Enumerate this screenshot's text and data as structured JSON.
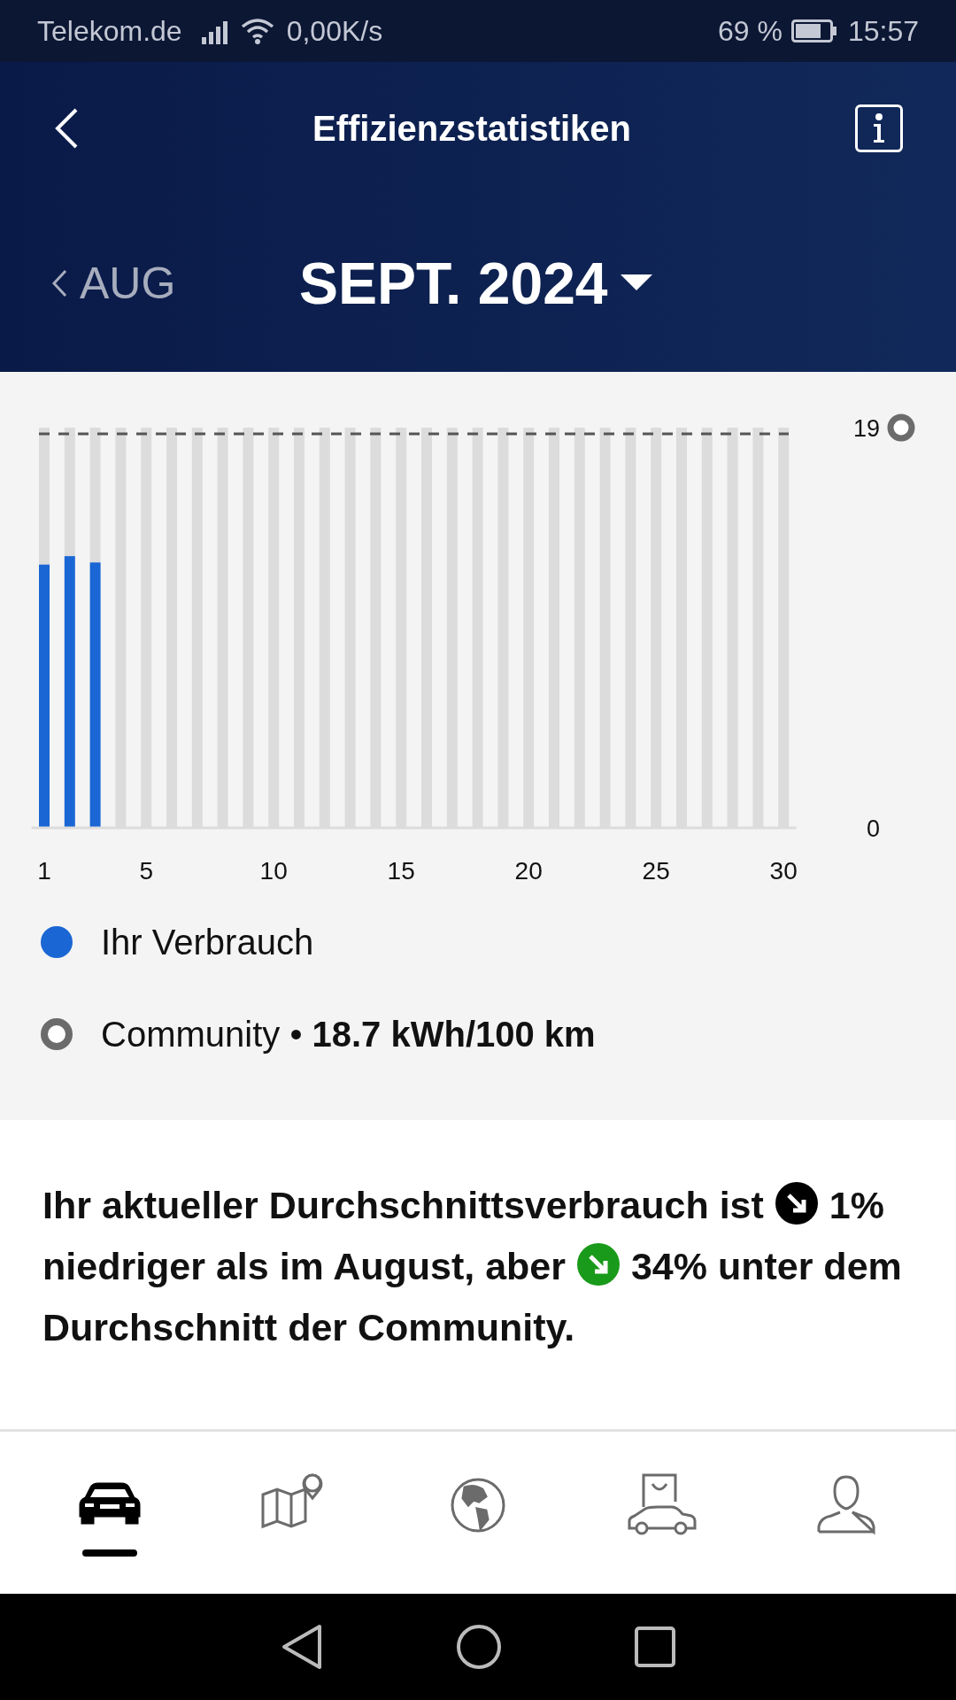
{
  "status_bar": {
    "carrier": "Telekom.de",
    "speed": "0,00K/s",
    "battery": "69 %",
    "time": "15:57"
  },
  "header": {
    "title": "Effizienzstatistiken",
    "prev_month": "AUG",
    "month": "SEPT. 2024"
  },
  "chart": {
    "chart_data": {
      "type": "bar",
      "x": [
        1,
        2,
        3
      ],
      "series": [
        {
          "name": "Ihr Verbrauch",
          "color": "#1a66d4",
          "values": [
            12.5,
            12.9,
            12.6
          ]
        }
      ],
      "xlim": [
        0.5,
        30.5
      ],
      "ylim": [
        0,
        19
      ],
      "yticks": [
        0,
        19
      ],
      "xticks": [
        1,
        5,
        10,
        15,
        20,
        25,
        30
      ]
    },
    "legend": [
      {
        "kind": "dot"
      },
      {
        "kind": "ring",
        "text": "Community • **18.7 kWh/100 km**"
      }
    ]
  },
  "summary": [
    {
      "kind": "text",
      "text": "Ihr aktueller Durchschnittsverbrauch ist"
    },
    {
      "kind": "arrow",
      "color": "#000000"
    },
    {
      "kind": "text",
      "text": "1% niedriger als im August, aber"
    },
    {
      "kind": "arrow",
      "color": "#1a9a1a"
    },
    {
      "kind": "text",
      "text": "34% unter dem Durchschnitt der Community."
    }
  ],
  "bottom_nav": [
    {
      "selected": true
    },
    {
      "selected": false
    },
    {
      "selected": false
    },
    {
      "selected": false
    },
    {
      "selected": false
    }
  ]
}
